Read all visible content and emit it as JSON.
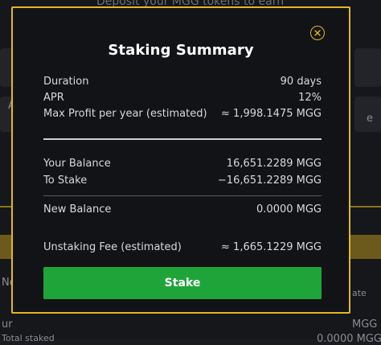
{
  "background": {
    "top_text": "Deposit your MGG tokens to earn",
    "left_text_1": "A",
    "left_text_2": "No",
    "left_text_3": "ur",
    "right_text_1": "e",
    "right_text_2": "ate",
    "right_text_3": "MGG",
    "right_text_4": "0.0000 MGG",
    "bottom_left_text": "Total staked"
  },
  "modal": {
    "title": "Staking Summary",
    "close_icon": "close-circle-icon",
    "rows_top": [
      {
        "label": "Duration",
        "value": "90 days"
      },
      {
        "label": "APR",
        "value": "12%"
      },
      {
        "label": "Max Profit per year (estimated)",
        "value": "≈ 1,998.1475 MGG"
      }
    ],
    "rows_balance": [
      {
        "label": "Your Balance",
        "value": "16,651.2289 MGG"
      },
      {
        "label": "To Stake",
        "value": "−16,651.2289 MGG"
      }
    ],
    "new_balance": {
      "label": "New Balance",
      "value": "0.0000 MGG"
    },
    "unstaking_fee": {
      "label": "Unstaking Fee (estimated)",
      "value": "≈ 1,665.1229 MGG"
    },
    "stake_button": "Stake"
  },
  "colors": {
    "accent_gold": "#e1b923",
    "stake_green": "#1fa43a",
    "modal_bg": "#121316"
  }
}
